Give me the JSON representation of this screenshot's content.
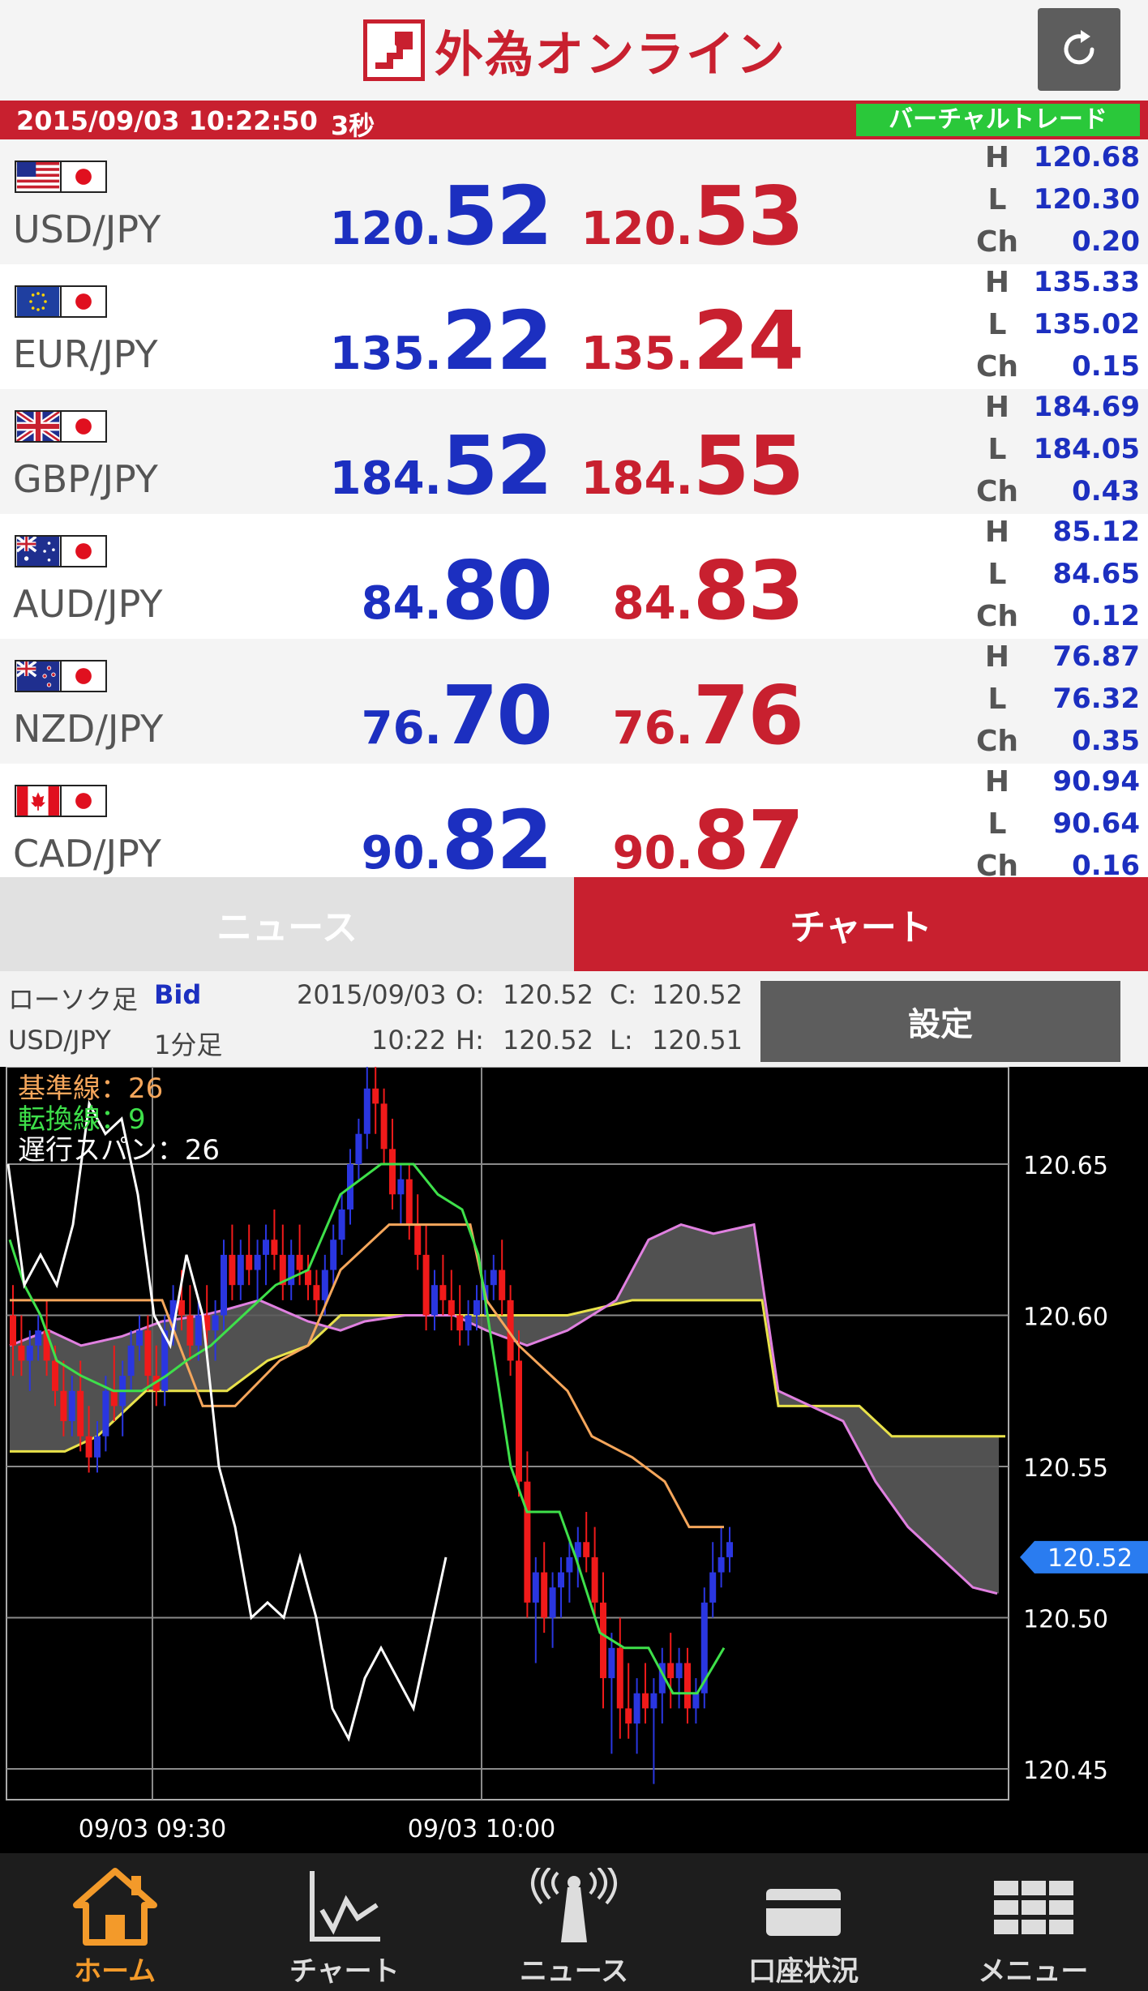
{
  "header": {
    "logo_text": "外為オンライン",
    "refresh_icon": "refresh-icon",
    "brand_color": "#c8202f"
  },
  "status": {
    "datetime": "2015/09/03 10:22:50",
    "interval": "3秒",
    "mode_badge": "バーチャルトレード"
  },
  "rates": [
    {
      "pair": "USD/JPY",
      "flags": [
        "us-flag-icon",
        "jp-flag-icon"
      ],
      "bid_int": "120.",
      "bid_frac": "52",
      "ask_int": "120.",
      "ask_frac": "53",
      "h": "120.68",
      "l": "120.30",
      "ch": "0.20"
    },
    {
      "pair": "EUR/JPY",
      "flags": [
        "eu-flag-icon",
        "jp-flag-icon"
      ],
      "bid_int": "135.",
      "bid_frac": "22",
      "ask_int": "135.",
      "ask_frac": "24",
      "h": "135.33",
      "l": "135.02",
      "ch": "0.15"
    },
    {
      "pair": "GBP/JPY",
      "flags": [
        "uk-flag-icon",
        "jp-flag-icon"
      ],
      "bid_int": "184.",
      "bid_frac": "52",
      "ask_int": "184.",
      "ask_frac": "55",
      "h": "184.69",
      "l": "184.05",
      "ch": "0.43"
    },
    {
      "pair": "AUD/JPY",
      "flags": [
        "au-flag-icon",
        "jp-flag-icon"
      ],
      "bid_int": "84.",
      "bid_frac": "80",
      "ask_int": "84.",
      "ask_frac": "83",
      "h": "85.12",
      "l": "84.65",
      "ch": "0.12"
    },
    {
      "pair": "NZD/JPY",
      "flags": [
        "nz-flag-icon",
        "jp-flag-icon"
      ],
      "bid_int": "76.",
      "bid_frac": "70",
      "ask_int": "76.",
      "ask_frac": "76",
      "h": "76.87",
      "l": "76.32",
      "ch": "0.35"
    },
    {
      "pair": "CAD/JPY",
      "flags": [
        "ca-flag-icon",
        "jp-flag-icon"
      ],
      "bid_int": "90.",
      "bid_frac": "82",
      "ask_int": "90.",
      "ask_frac": "87",
      "h": "90.94",
      "l": "90.64",
      "ch": "0.16"
    }
  ],
  "hlc_labels": {
    "h": "H",
    "l": "L",
    "ch": "Ch"
  },
  "tabs": {
    "news": "ニュース",
    "chart": "チャート"
  },
  "chart_info": {
    "chart_kind": "ローソク足",
    "price_side": "Bid",
    "pair": "USD/JPY",
    "timeframe": "1分足",
    "date": "2015/09/03",
    "time": "10:22",
    "open_label": "O:",
    "open": "120.52",
    "close_label": "C:",
    "close": "120.52",
    "high_label": "H:",
    "high": "120.52",
    "low_label": "L:",
    "low": "120.51",
    "settings_label": "設定"
  },
  "legend": {
    "kijun": "基準線：26",
    "tenkan": "転換線：9",
    "chikou": "遅行スパン：26"
  },
  "chart_data": {
    "type": "candlestick",
    "ylim": [
      120.44,
      120.69
    ],
    "y_ticks": [
      "120.65",
      "120.60",
      "120.55",
      "120.50",
      "120.45"
    ],
    "x_ticks": [
      "09/03 09:30",
      "09/03 10:00"
    ],
    "current_price": "120.52",
    "colors": {
      "up": "#2a36e0",
      "down": "#f01a1a",
      "kijun": "#f5a65b",
      "tenkan": "#3ee04a",
      "chikou": "#ffffff",
      "span_a": "#e9e24a",
      "span_b": "#e080e0",
      "cloud": "#5a5a5a"
    },
    "candles": [
      [
        120.6,
        120.61,
        120.58,
        120.59
      ],
      [
        120.59,
        120.6,
        120.58,
        120.585
      ],
      [
        120.585,
        120.595,
        120.575,
        120.59
      ],
      [
        120.59,
        120.6,
        120.585,
        120.595
      ],
      [
        120.595,
        120.605,
        120.58,
        120.585
      ],
      [
        120.585,
        120.59,
        120.57,
        120.575
      ],
      [
        120.575,
        120.585,
        120.56,
        120.565
      ],
      [
        120.565,
        120.58,
        120.56,
        120.575
      ],
      [
        120.575,
        120.585,
        120.555,
        120.56
      ],
      [
        120.56,
        120.57,
        120.548,
        120.553
      ],
      [
        120.553,
        120.565,
        120.548,
        120.56
      ],
      [
        120.56,
        120.58,
        120.555,
        120.575
      ],
      [
        120.575,
        120.59,
        120.565,
        120.57
      ],
      [
        120.57,
        120.585,
        120.56,
        120.58
      ],
      [
        120.58,
        120.595,
        120.575,
        120.59
      ],
      [
        120.59,
        120.6,
        120.585,
        120.595
      ],
      [
        120.595,
        120.6,
        120.575,
        120.58
      ],
      [
        120.58,
        120.59,
        120.57,
        120.575
      ],
      [
        120.575,
        120.6,
        120.57,
        120.595
      ],
      [
        120.595,
        120.61,
        120.59,
        120.605
      ],
      [
        120.605,
        120.615,
        120.595,
        120.6
      ],
      [
        120.6,
        120.61,
        120.585,
        120.59
      ],
      [
        120.59,
        120.605,
        120.585,
        120.6
      ],
      [
        120.6,
        120.61,
        120.59,
        120.595
      ],
      [
        120.595,
        120.605,
        120.585,
        120.6
      ],
      [
        120.6,
        120.625,
        120.595,
        120.62
      ],
      [
        120.62,
        120.63,
        120.605,
        120.61
      ],
      [
        120.61,
        120.625,
        120.605,
        120.62
      ],
      [
        120.62,
        120.63,
        120.61,
        120.615
      ],
      [
        120.615,
        120.625,
        120.605,
        120.62
      ],
      [
        120.62,
        120.63,
        120.61,
        120.625
      ],
      [
        120.625,
        120.635,
        120.615,
        120.62
      ],
      [
        120.62,
        120.63,
        120.605,
        120.61
      ],
      [
        120.61,
        120.625,
        120.605,
        120.62
      ],
      [
        120.62,
        120.63,
        120.61,
        120.615
      ],
      [
        120.615,
        120.62,
        120.605,
        120.61
      ],
      [
        120.61,
        120.615,
        120.6,
        120.605
      ],
      [
        120.605,
        120.62,
        120.6,
        120.615
      ],
      [
        120.615,
        120.63,
        120.61,
        120.625
      ],
      [
        120.625,
        120.64,
        120.62,
        120.635
      ],
      [
        120.635,
        120.655,
        120.63,
        120.65
      ],
      [
        120.65,
        120.665,
        120.645,
        120.66
      ],
      [
        120.66,
        120.685,
        120.655,
        120.675
      ],
      [
        120.675,
        120.685,
        120.66,
        120.67
      ],
      [
        120.67,
        120.675,
        120.65,
        120.655
      ],
      [
        120.655,
        120.665,
        120.635,
        120.64
      ],
      [
        120.64,
        120.65,
        120.63,
        120.645
      ],
      [
        120.645,
        120.65,
        120.625,
        120.63
      ],
      [
        120.63,
        120.64,
        120.615,
        120.62
      ],
      [
        120.62,
        120.63,
        120.595,
        120.6
      ],
      [
        120.6,
        120.615,
        120.595,
        120.61
      ],
      [
        120.61,
        120.62,
        120.6,
        120.605
      ],
      [
        120.605,
        120.615,
        120.595,
        120.6
      ],
      [
        120.6,
        120.61,
        120.59,
        120.595
      ],
      [
        120.595,
        120.605,
        120.59,
        120.6
      ],
      [
        120.6,
        120.61,
        120.595,
        120.605
      ],
      [
        120.605,
        120.615,
        120.6,
        120.61
      ],
      [
        120.61,
        120.62,
        120.605,
        120.615
      ],
      [
        120.615,
        120.625,
        120.6,
        120.605
      ],
      [
        120.605,
        120.61,
        120.58,
        120.585
      ],
      [
        120.585,
        120.595,
        120.54,
        120.545
      ],
      [
        120.545,
        120.555,
        120.5,
        120.505
      ],
      [
        120.505,
        120.52,
        120.485,
        120.515
      ],
      [
        120.515,
        120.525,
        120.495,
        120.5
      ],
      [
        120.5,
        120.515,
        120.49,
        120.51
      ],
      [
        120.51,
        120.52,
        120.5,
        120.515
      ],
      [
        120.515,
        120.525,
        120.505,
        120.52
      ],
      [
        120.52,
        120.53,
        120.51,
        120.525
      ],
      [
        120.525,
        120.535,
        120.515,
        120.52
      ],
      [
        120.52,
        120.53,
        120.5,
        120.505
      ],
      [
        120.505,
        120.515,
        120.47,
        120.48
      ],
      [
        120.48,
        120.495,
        120.455,
        120.49
      ],
      [
        120.49,
        120.5,
        120.46,
        120.47
      ],
      [
        120.47,
        120.485,
        120.46,
        120.465
      ],
      [
        120.465,
        120.48,
        120.455,
        120.475
      ],
      [
        120.475,
        120.485,
        120.465,
        120.47
      ],
      [
        120.47,
        120.48,
        120.445,
        120.475
      ],
      [
        120.475,
        120.49,
        120.465,
        120.485
      ],
      [
        120.485,
        120.495,
        120.47,
        120.48
      ],
      [
        120.48,
        120.49,
        120.47,
        120.485
      ],
      [
        120.485,
        120.49,
        120.465,
        120.47
      ],
      [
        120.47,
        120.48,
        120.465,
        120.475
      ],
      [
        120.475,
        120.51,
        120.47,
        120.505
      ],
      [
        120.505,
        120.525,
        120.5,
        120.515
      ],
      [
        120.515,
        120.53,
        120.51,
        120.52
      ],
      [
        120.52,
        120.53,
        120.515,
        120.525
      ]
    ],
    "kijun": [
      [
        12,
        120.605
      ],
      [
        36,
        120.605
      ],
      [
        60,
        120.605
      ],
      [
        100,
        120.605
      ],
      [
        130,
        120.605
      ],
      [
        200,
        120.605
      ],
      [
        250,
        120.57
      ],
      [
        290,
        120.57
      ],
      [
        345,
        120.585
      ],
      [
        380,
        120.59
      ],
      [
        420,
        120.615
      ],
      [
        480,
        120.63
      ],
      [
        530,
        120.63
      ],
      [
        560,
        120.63
      ],
      [
        580,
        120.63
      ],
      [
        600,
        120.605
      ],
      [
        640,
        120.59
      ],
      [
        680,
        120.58
      ],
      [
        700,
        120.575
      ],
      [
        730,
        120.56
      ],
      [
        780,
        120.553
      ],
      [
        820,
        120.545
      ],
      [
        850,
        120.53
      ],
      [
        870,
        120.53
      ],
      [
        893,
        120.53
      ]
    ],
    "tenkan": [
      [
        12,
        120.625
      ],
      [
        30,
        120.61
      ],
      [
        50,
        120.6
      ],
      [
        70,
        120.585
      ],
      [
        100,
        120.58
      ],
      [
        140,
        120.575
      ],
      [
        175,
        120.575
      ],
      [
        205,
        120.58
      ],
      [
        230,
        120.585
      ],
      [
        260,
        120.59
      ],
      [
        300,
        120.6
      ],
      [
        340,
        120.61
      ],
      [
        380,
        120.615
      ],
      [
        420,
        120.64
      ],
      [
        470,
        120.65
      ],
      [
        510,
        120.65
      ],
      [
        540,
        120.64
      ],
      [
        570,
        120.635
      ],
      [
        590,
        120.62
      ],
      [
        610,
        120.585
      ],
      [
        630,
        120.55
      ],
      [
        650,
        120.535
      ],
      [
        690,
        120.535
      ],
      [
        710,
        120.52
      ],
      [
        740,
        120.495
      ],
      [
        770,
        120.49
      ],
      [
        800,
        120.49
      ],
      [
        830,
        120.475
      ],
      [
        860,
        120.475
      ],
      [
        893,
        120.49
      ]
    ],
    "chikou": [
      [
        10,
        120.65
      ],
      [
        30,
        120.61
      ],
      [
        50,
        120.62
      ],
      [
        70,
        120.61
      ],
      [
        90,
        120.63
      ],
      [
        110,
        120.67
      ],
      [
        130,
        120.66
      ],
      [
        150,
        120.665
      ],
      [
        170,
        120.64
      ],
      [
        190,
        120.6
      ],
      [
        210,
        120.59
      ],
      [
        230,
        120.62
      ],
      [
        250,
        120.6
      ],
      [
        270,
        120.55
      ],
      [
        290,
        120.53
      ],
      [
        310,
        120.5
      ],
      [
        330,
        120.505
      ],
      [
        350,
        120.5
      ],
      [
        370,
        120.52
      ],
      [
        390,
        120.5
      ],
      [
        410,
        120.47
      ],
      [
        430,
        120.46
      ],
      [
        450,
        120.48
      ],
      [
        470,
        120.49
      ],
      [
        490,
        120.48
      ],
      [
        510,
        120.47
      ],
      [
        530,
        120.495
      ],
      [
        550,
        120.52
      ]
    ],
    "span_a": [
      [
        12,
        120.555
      ],
      [
        80,
        120.555
      ],
      [
        120,
        120.56
      ],
      [
        180,
        120.575
      ],
      [
        240,
        120.575
      ],
      [
        280,
        120.575
      ],
      [
        330,
        120.585
      ],
      [
        380,
        120.59
      ],
      [
        420,
        120.6
      ],
      [
        500,
        120.6
      ],
      [
        560,
        120.6
      ],
      [
        640,
        120.6
      ],
      [
        700,
        120.6
      ],
      [
        780,
        120.605
      ],
      [
        860,
        120.605
      ],
      [
        940,
        120.605
      ],
      [
        960,
        120.57
      ],
      [
        1060,
        120.57
      ],
      [
        1100,
        120.56
      ],
      [
        1240,
        120.56
      ]
    ],
    "span_b": [
      [
        12,
        120.59
      ],
      [
        60,
        120.595
      ],
      [
        100,
        120.59
      ],
      [
        150,
        120.593
      ],
      [
        200,
        120.598
      ],
      [
        250,
        120.6
      ],
      [
        280,
        120.602
      ],
      [
        320,
        120.605
      ],
      [
        380,
        120.598
      ],
      [
        420,
        120.595
      ],
      [
        450,
        120.598
      ],
      [
        500,
        120.6
      ],
      [
        560,
        120.6
      ],
      [
        600,
        120.595
      ],
      [
        650,
        120.59
      ],
      [
        700,
        120.595
      ],
      [
        760,
        120.605
      ],
      [
        800,
        120.625
      ],
      [
        840,
        120.63
      ],
      [
        880,
        120.627
      ],
      [
        930,
        120.63
      ],
      [
        960,
        120.575
      ],
      [
        1040,
        120.565
      ],
      [
        1080,
        120.545
      ],
      [
        1120,
        120.53
      ],
      [
        1160,
        120.52
      ],
      [
        1200,
        120.51
      ],
      [
        1230,
        120.508
      ]
    ]
  },
  "nav": [
    {
      "label": "ホーム",
      "icon": "home-icon"
    },
    {
      "label": "チャート",
      "icon": "chart-icon"
    },
    {
      "label": "ニュース",
      "icon": "broadcast-icon"
    },
    {
      "label": "口座状況",
      "icon": "account-icon"
    },
    {
      "label": "メニュー",
      "icon": "menu-grid-icon"
    }
  ]
}
